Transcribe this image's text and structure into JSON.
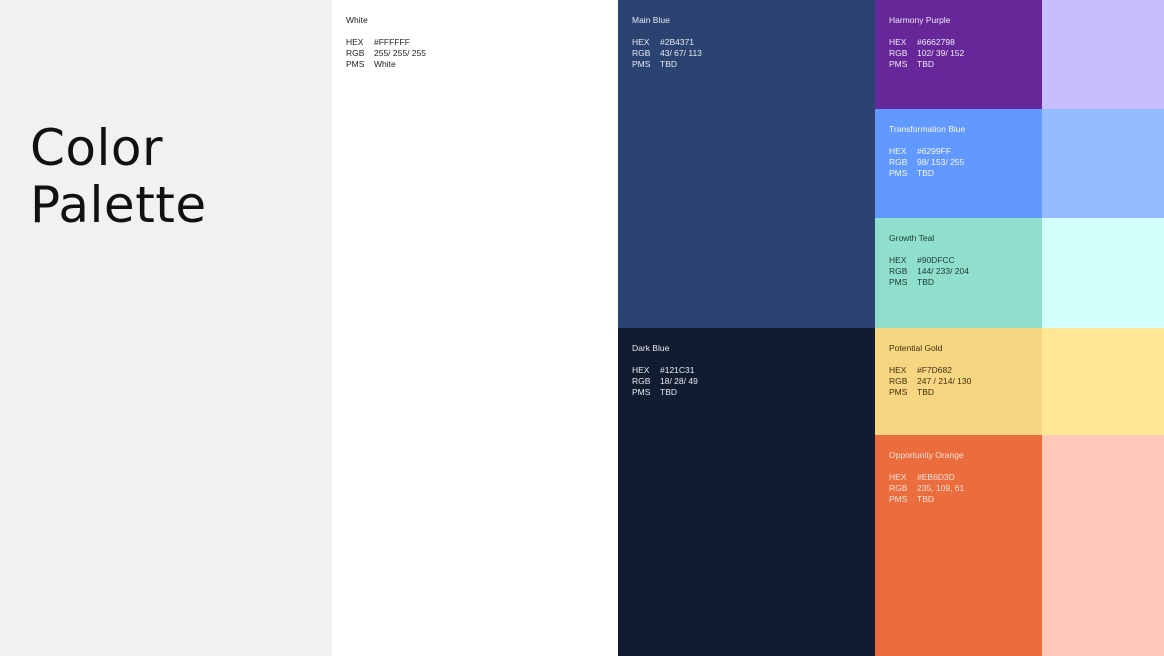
{
  "title": {
    "line1": "Color",
    "line2": "Palette"
  },
  "labels": {
    "hex": "HEX",
    "rgb": "RGB",
    "pms": "PMS"
  },
  "swatches": {
    "white": {
      "name": "White",
      "hex": "#FFFFFF",
      "rgb": "255/ 255/ 255",
      "pms": "White",
      "color": "#FFFFFF",
      "text_color": "#222222"
    },
    "main_blue": {
      "name": "Main Blue",
      "hex": "#2B4371",
      "rgb": "43/ 67/ 113",
      "pms": "TBD",
      "color": "#2B4371",
      "text_color": "#E6EAF2"
    },
    "dark_blue": {
      "name": "Dark Blue",
      "hex": "#121C31",
      "rgb": "18/ 28/ 49",
      "pms": "TBD",
      "color": "#121C31",
      "text_color": "#E6EAF2"
    },
    "harmony_purple": {
      "name": "Harmony Purple",
      "hex": "#6662798",
      "rgb": "102/ 39/ 152",
      "pms": "TBD",
      "color": "#662798",
      "text_color": "#F1E8FA"
    },
    "transformation_blue": {
      "name": "Transformation Blue",
      "hex": "#6299FF",
      "rgb": "98/ 153/ 255",
      "pms": "TBD",
      "color": "#6299FF",
      "text_color": "#F3F7FF"
    },
    "growth_teal": {
      "name": "Growth Teal",
      "hex": "#90DFCC",
      "rgb": "144/ 233/ 204",
      "pms": "TBD",
      "color": "#90DFCC",
      "text_color": "#1B3B34"
    },
    "potential_gold": {
      "name": "Potential Gold",
      "hex": "#F7D682",
      "rgb": "247 / 214/ 130",
      "pms": "TBD",
      "color": "#F7D682",
      "text_color": "#3E3010"
    },
    "opportunity_orange": {
      "name": "Opportunity Orange",
      "hex": "#EB6D3D",
      "rgb": "235, 109, 61",
      "pms": "TBD",
      "color": "#EB6D3D",
      "text_color": "#FBE3D9"
    }
  },
  "tints": {
    "purple_tint": "#C8BEFF",
    "blue_tint": "#93BCFF",
    "teal_tint": "#D3FFFD",
    "gold_tint": "#FFE796",
    "orange_tint": "#FFC8B7"
  }
}
